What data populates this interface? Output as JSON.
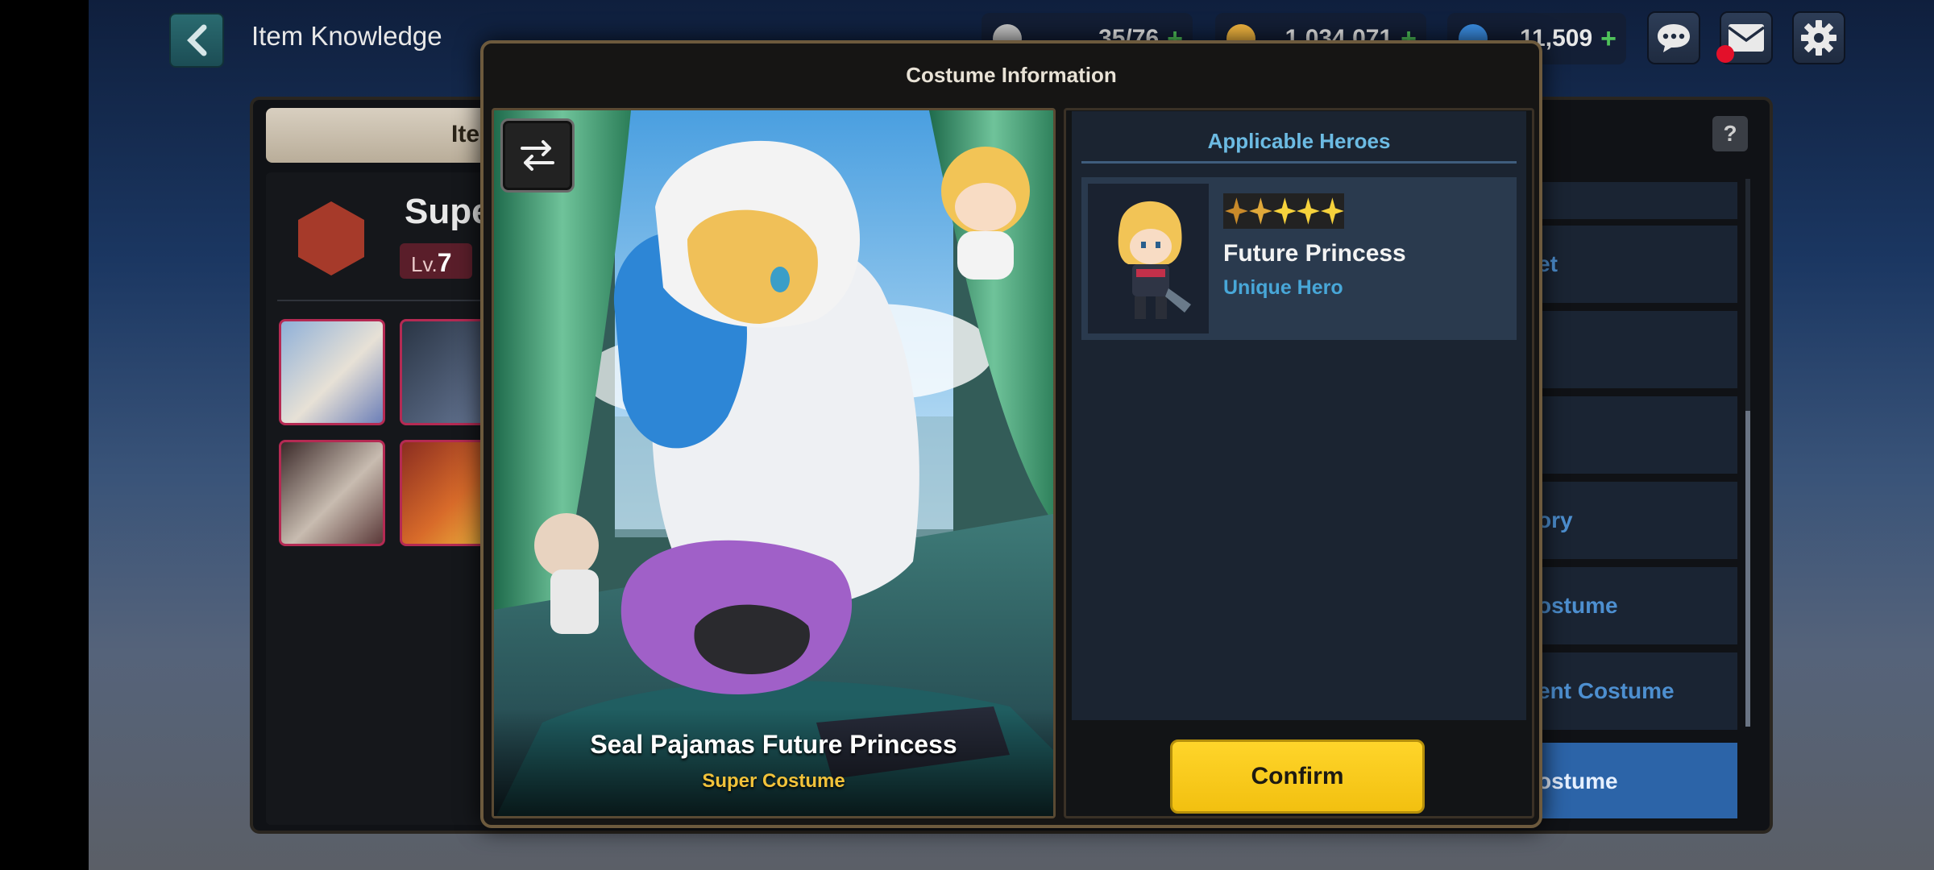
{
  "screen": {
    "title": "Item Knowledge",
    "back_icon": "chevron-left-icon"
  },
  "currencies": [
    {
      "icon": "stamina-cup-icon",
      "value": "35/76",
      "color": "#c6c6c6"
    },
    {
      "icon": "gold-coin-icon",
      "value": "1,034,071",
      "color": "#f2b640"
    },
    {
      "icon": "gem-globe-icon",
      "value": "11,509",
      "color": "#3a8de2"
    }
  ],
  "top_icons": [
    "chat-icon",
    "mail-icon",
    "gear-icon"
  ],
  "background": {
    "tab_label": "Ite",
    "item_name": "Supe",
    "level_prefix": "Lv.",
    "level_value": "7",
    "right_rows": [
      "",
      "et",
      "",
      "",
      "ory",
      "ostume",
      "ent Costume",
      "ostume"
    ],
    "help_label": "?"
  },
  "modal": {
    "title": "Costume Information",
    "swap_icon": "swap-arrows-icon",
    "costume_name": "Seal Pajamas Future Princess",
    "costume_type": "Super Costume",
    "applicable_heroes_title": "Applicable Heroes",
    "hero": {
      "stars": 5,
      "name": "Future Princess",
      "rank": "Unique Hero"
    },
    "confirm_label": "Confirm"
  },
  "colors": {
    "accent_yellow": "#f2c010",
    "hero_blue": "#48a7d8",
    "title_blue": "#6cbbe3",
    "costume_gold": "#f1c23a",
    "modal_border": "#6d5a3d"
  }
}
